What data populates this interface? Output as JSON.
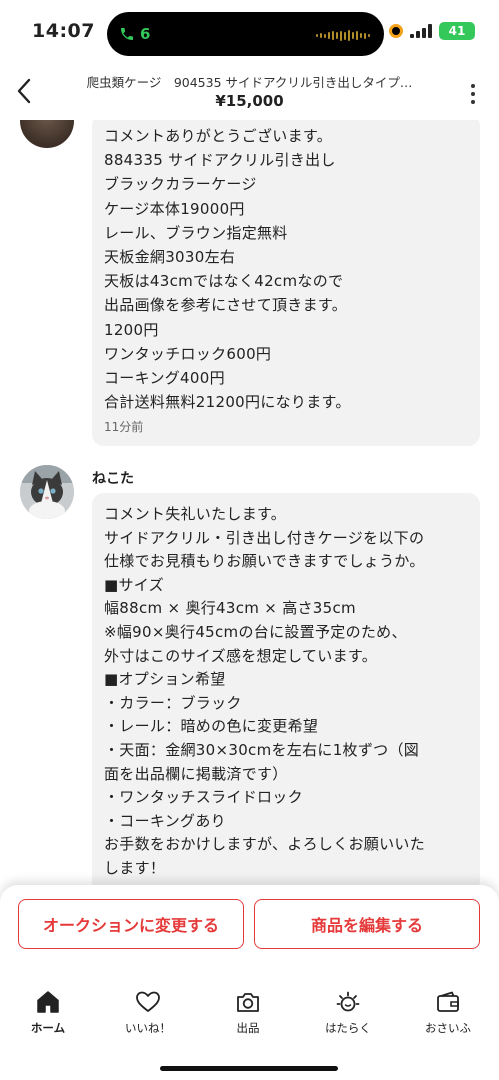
{
  "status_bar": {
    "time": "14:07",
    "call_count": "6",
    "battery": "41"
  },
  "header": {
    "title": "爬虫類ケージ　904535 サイドアクリル引き出しタイプ…",
    "price": "¥15,000"
  },
  "messages": [
    {
      "lines": [
        "コメントありがとうございます。",
        "884335 サイドアクリル引き出し",
        "ブラックカラーケージ",
        "ケージ本体19000円",
        "レール、ブラウン指定無料",
        "天板金網3030左右",
        "天板は43cmではなく42cmなので",
        "出品画像を参考にさせて頂きます。",
        "1200円",
        "ワンタッチロック600円",
        "コーキング400円",
        "合計送料無料21200円になります。"
      ],
      "time": "11分前"
    },
    {
      "user": "ねこた",
      "lines": [
        "コメント失礼いたします。",
        "サイドアクリル・引き出し付きケージを以下の",
        "仕様でお見積もりお願いできますでしょうか。",
        "■サイズ",
        "幅88cm × 奥行43cm × 高さ35cm",
        "※幅90×奥行45cmの台に設置予定のため、",
        "外寸はこのサイズ感を想定しています。",
        "■オプション希望",
        "・カラー：ブラック",
        "・レール：暗めの色に変更希望",
        "・天面：金網30×30cmを左右に1枚ずつ（図",
        "面を出品欄に掲載済です）",
        "・ワンタッチスライドロック",
        "・コーキングあり",
        "お手数をおかけしますが、よろしくお願いいた",
        "します！"
      ]
    }
  ],
  "actions": {
    "auction": "オークションに変更する",
    "edit": "商品を編集する"
  },
  "tabs": [
    {
      "label": "ホーム",
      "icon": "home-icon"
    },
    {
      "label": "いいね！",
      "icon": "heart-icon"
    },
    {
      "label": "出品",
      "icon": "camera-icon"
    },
    {
      "label": "はたらく",
      "icon": "sun-icon"
    },
    {
      "label": "おさいふ",
      "icon": "wallet-icon"
    }
  ],
  "colors": {
    "accent": "#e63a3a",
    "bubble": "#f2f2f2",
    "call_green": "#34c759"
  }
}
